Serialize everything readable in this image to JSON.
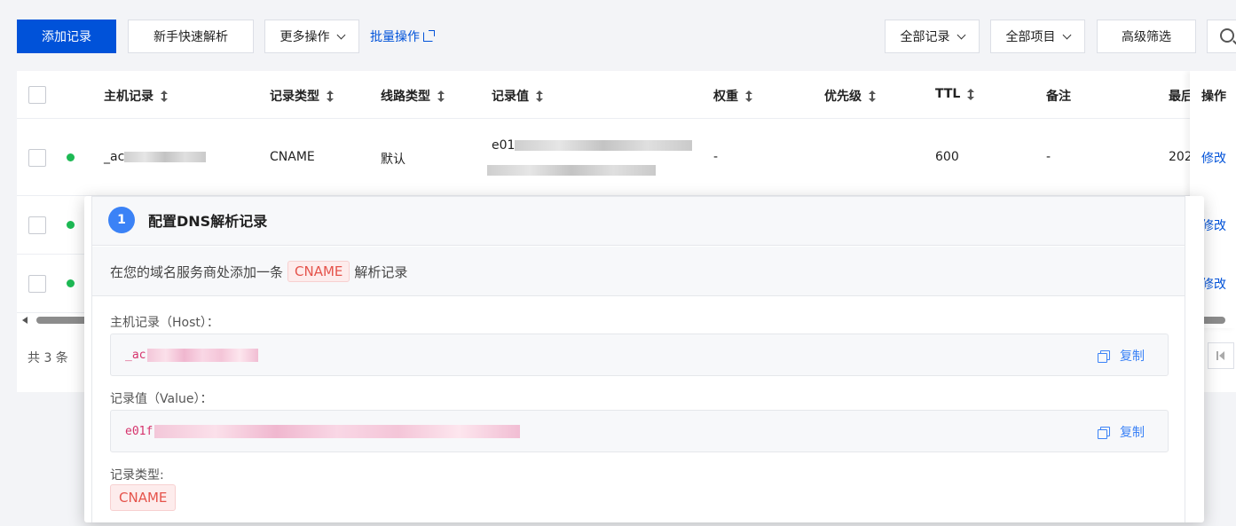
{
  "toolbar": {
    "add_record": "添加记录",
    "quick_parse": "新手快速解析",
    "more_ops": "更多操作",
    "batch_ops": "批量操作",
    "all_records": "全部记录",
    "all_items": "全部项目",
    "advanced_filter": "高级筛选"
  },
  "table": {
    "columns": [
      "主机记录",
      "记录类型",
      "线路类型",
      "记录值",
      "权重",
      "优先级",
      "TTL",
      "备注",
      "最后",
      "操作"
    ],
    "rows": [
      {
        "host_prefix": "_ac",
        "type": "CNAME",
        "line": "默认",
        "value_prefix": "e01",
        "weight": "-",
        "ttl": "600",
        "remark": "-",
        "updated": "202",
        "action": "修改"
      },
      {
        "action": "修改"
      },
      {
        "action": "修改"
      }
    ],
    "footer_total": "共 3 条"
  },
  "modal": {
    "step_number": "1",
    "step_title": "配置DNS解析记录",
    "desc_before": "在您的域名服务商处添加一条",
    "desc_tag": "CNAME",
    "desc_after": "解析记录",
    "host_label": "主机记录（Host）：",
    "host_value_prefix": "_ac",
    "value_label": "记录值（Value）：",
    "value_prefix": "e01f",
    "copy_label": "复制",
    "type_label": "记录类型:",
    "type_value": "CNAME"
  },
  "colors": {
    "primary": "#0052d9",
    "status_dot": "#1db954",
    "tag_text": "#e5534b",
    "step_badge": "#3b82f6"
  }
}
